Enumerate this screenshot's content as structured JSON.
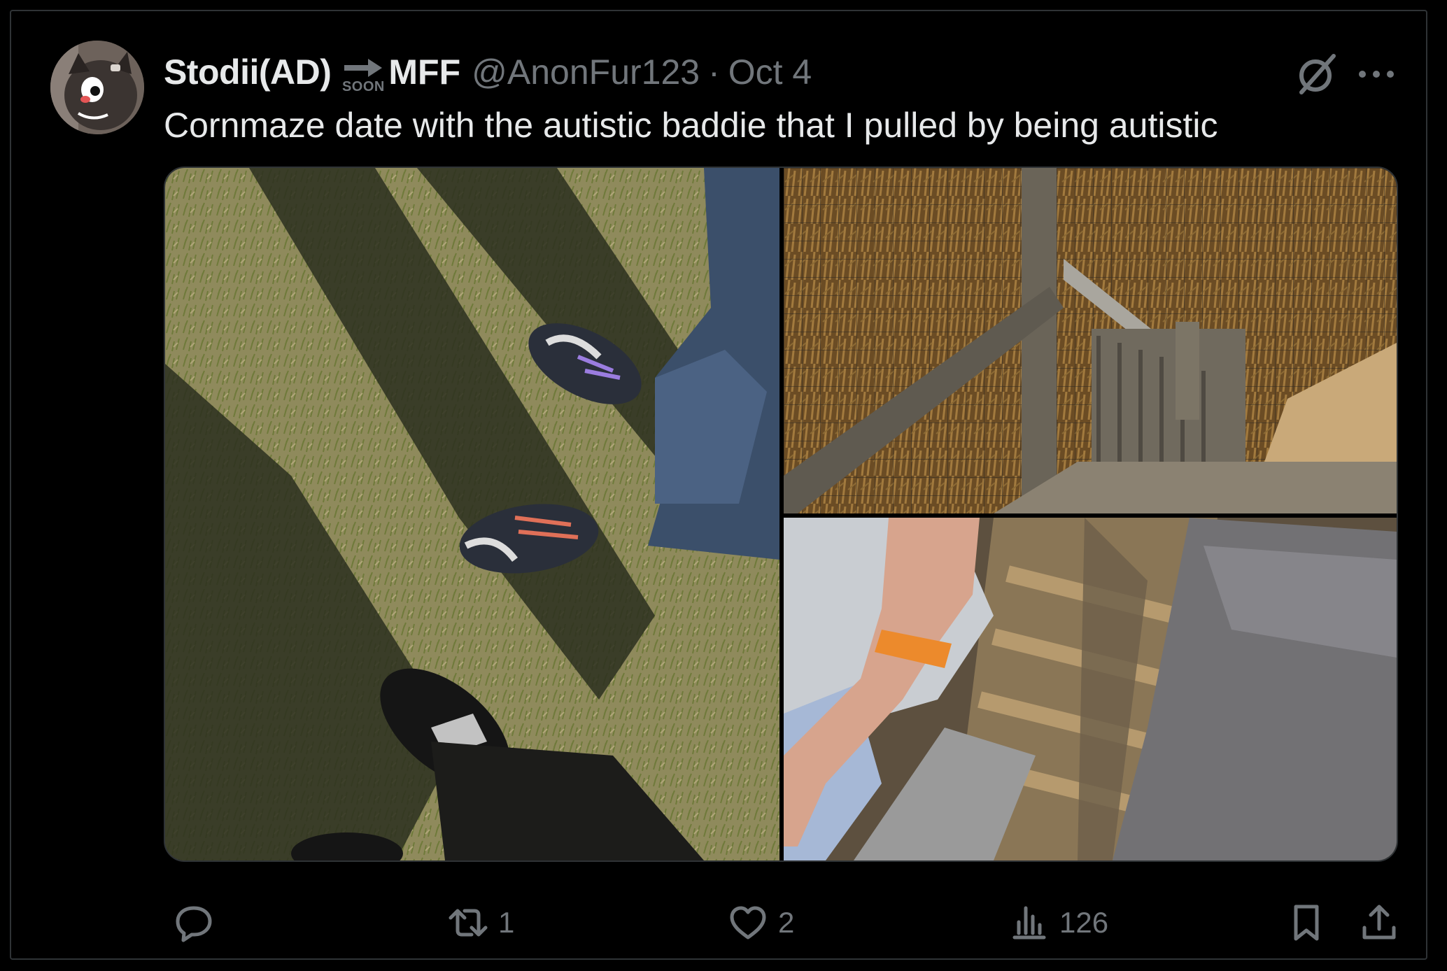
{
  "post": {
    "display_name": "Stodii(AD)",
    "badge_text": "SOON",
    "display_name_suffix": "MFF",
    "handle": "@AnonFur123",
    "separator": "·",
    "date": "Oct 4",
    "text": "Cornmaze date with the autistic baddie that I pulled by being autistic"
  },
  "actions": {
    "reply_count": "",
    "retweet_count": "1",
    "like_count": "2",
    "views_count": "126"
  },
  "icons": {
    "header": [
      "grok-icon",
      "more-icon"
    ],
    "actions": [
      "reply-icon",
      "retweet-icon",
      "like-icon",
      "views-icon",
      "bookmark-icon",
      "share-icon"
    ]
  },
  "colors": {
    "background": "#000000",
    "text_primary": "#e7e9ea",
    "text_secondary": "#71767b",
    "border": "#2f3336"
  }
}
